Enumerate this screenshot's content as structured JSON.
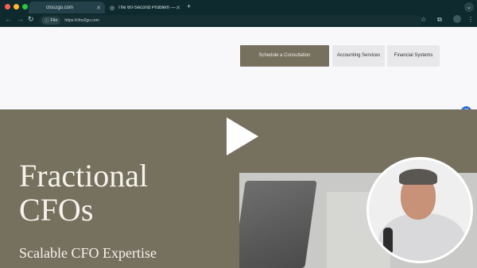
{
  "browser": {
    "window_controls": {
      "close_color": "#ff5f57",
      "minimize_color": "#febc2e",
      "zoom_color": "#28c840"
    },
    "tabs": [
      {
        "title": "cfos2go.com",
        "active": true
      },
      {
        "title": "The 60-Second Problem — ",
        "active": false
      }
    ],
    "new_tab": "+",
    "tab_menu": "⌄",
    "address": {
      "pill_label": "File",
      "url": "https://cfos2go.com"
    },
    "icons": [
      "back-icon",
      "forward-icon",
      "reload-icon",
      "bookmark-star-icon",
      "extensions-icon",
      "profile-icon",
      "menu-icon"
    ]
  },
  "site": {
    "nav": {
      "primary_cta": "Schedule a Consultation",
      "accounting": "Accounting Services",
      "financial": "Financial Systems"
    },
    "hero": {
      "title_line1": "Fractional",
      "title_line2": "CFOs",
      "subtitle": "Scalable CFO Expertise"
    },
    "colors": {
      "hero_bg": "#76705f",
      "primary_button": "#76705f",
      "accessibility": "#1f6fd6"
    }
  }
}
